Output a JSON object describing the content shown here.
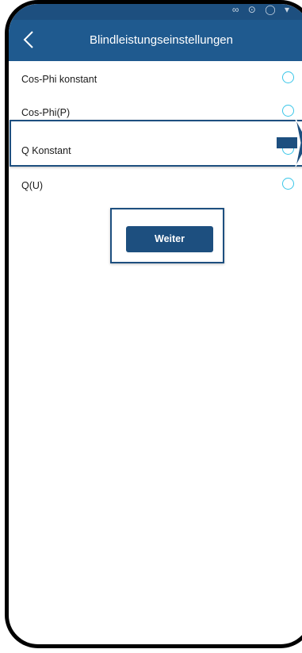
{
  "colors": {
    "header": "#1f5a8f",
    "status_bar": "#1d4f7f",
    "radio": "#39c6e8",
    "button": "#1d4f7f",
    "highlight": "#1d4f7f"
  },
  "header": {
    "title": "Blindleistungseinstellungen",
    "back_icon": "chevron-left-icon"
  },
  "options": [
    {
      "label": "Cos-Phi konstant",
      "selected": false
    },
    {
      "label": "Cos-Phi(P)",
      "selected": false
    },
    {
      "label": "Q Konstant",
      "selected": false
    },
    {
      "label": "Q(U)",
      "selected": false
    }
  ],
  "button": {
    "label": "Weiter"
  },
  "annotation": {
    "pointer_icon": "arrow-right-icon"
  }
}
